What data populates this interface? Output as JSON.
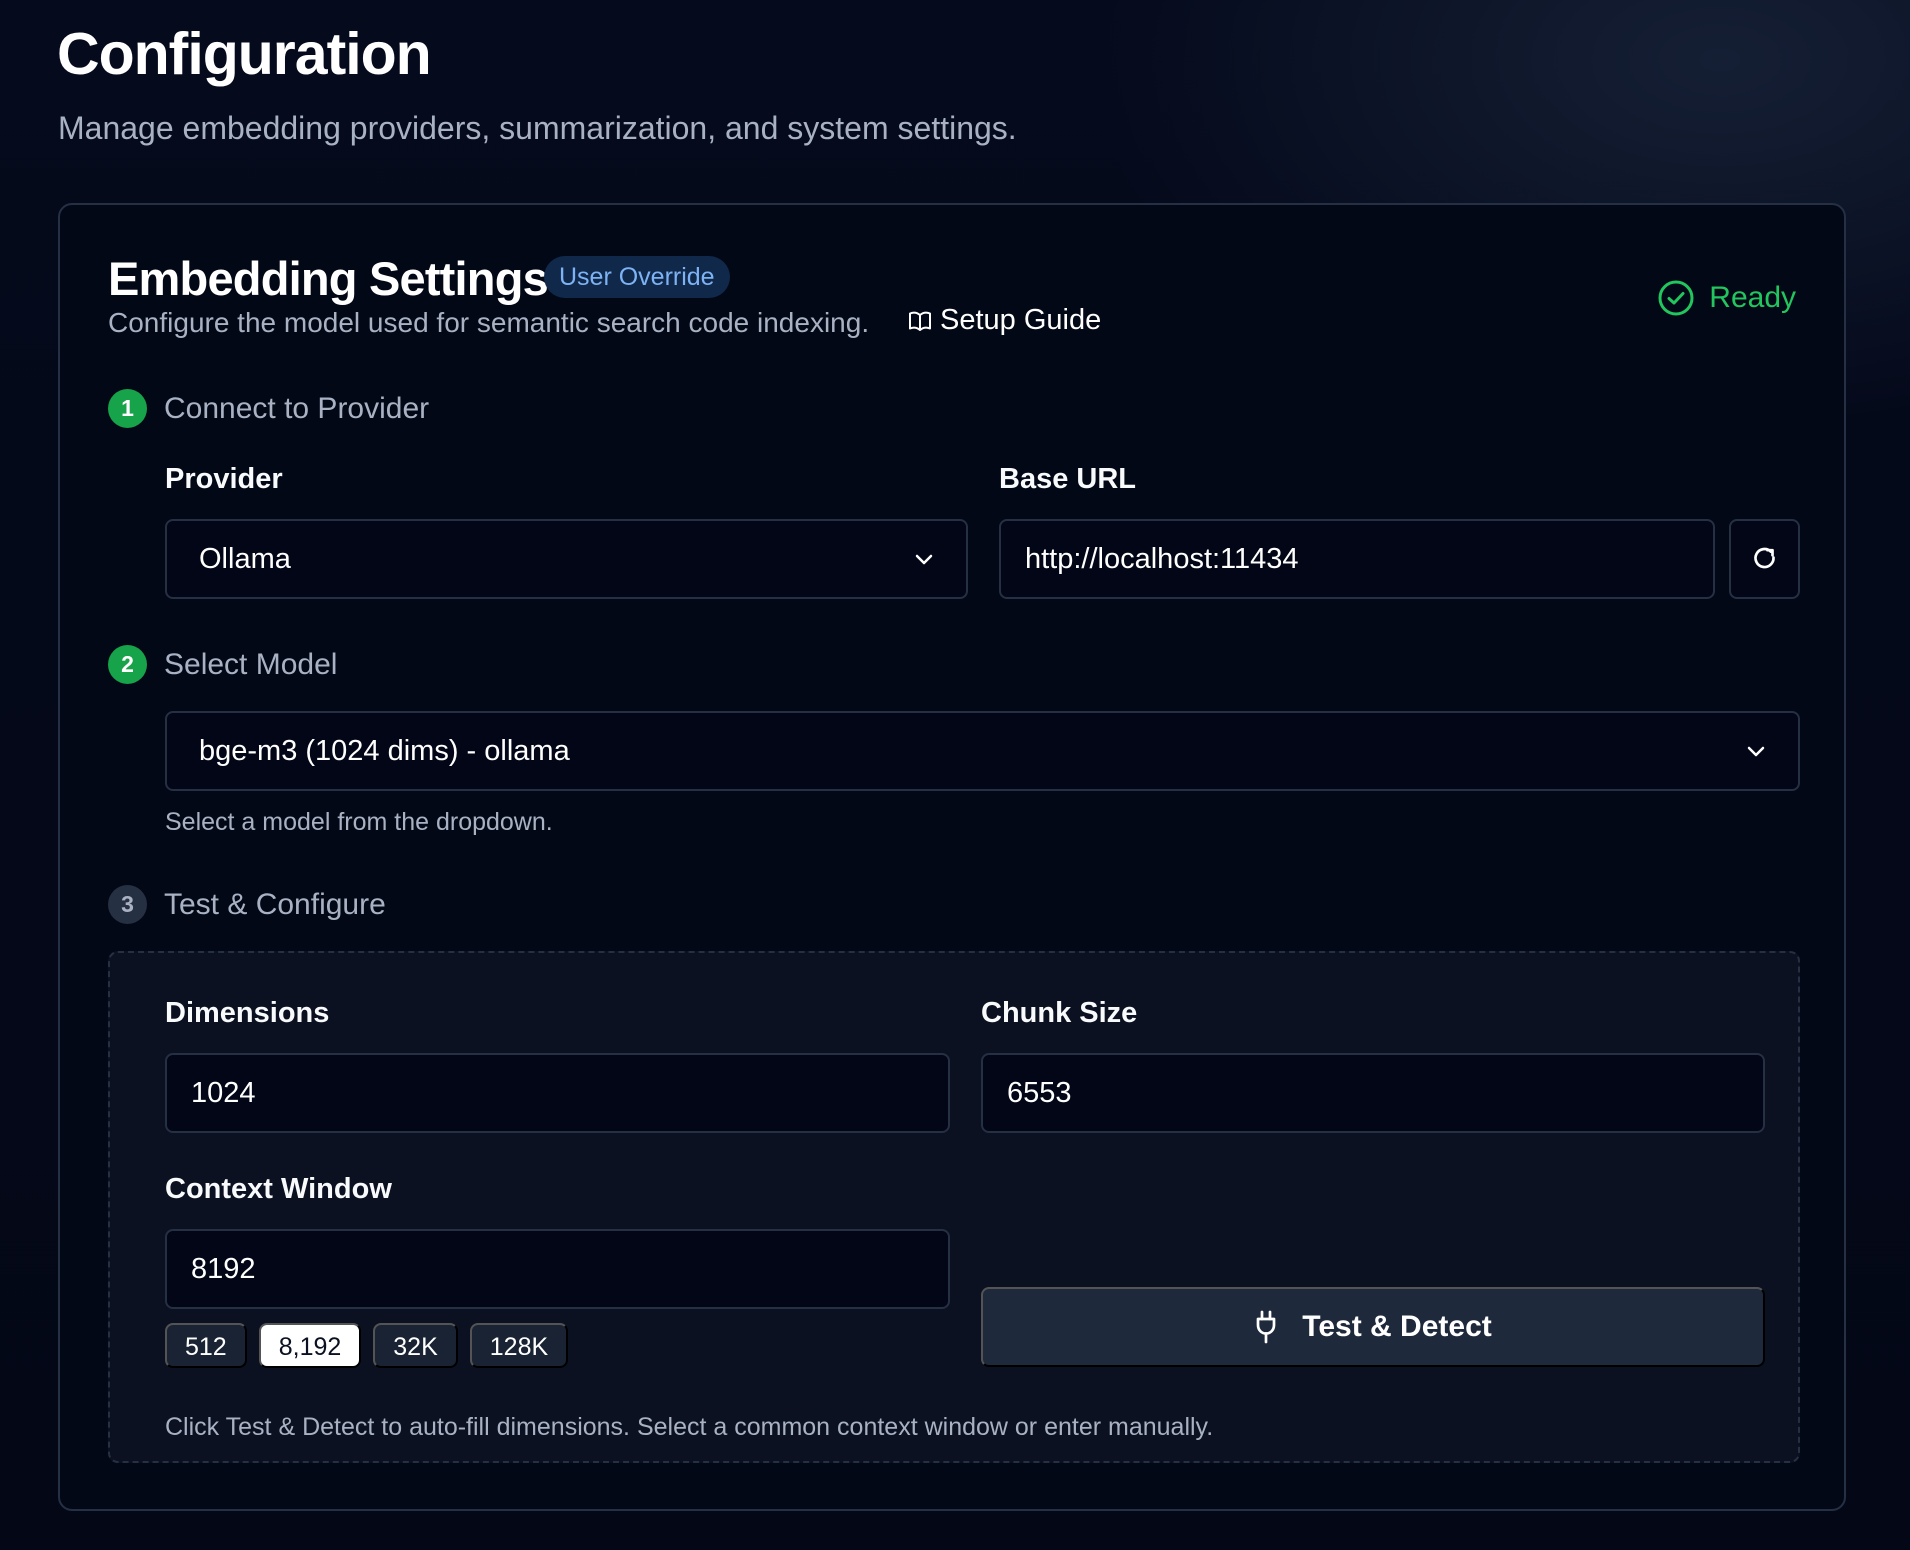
{
  "page": {
    "title": "Configuration",
    "subtitle": "Manage embedding providers, summarization, and system settings."
  },
  "card": {
    "title": "Embedding Settings",
    "badge": "User Override",
    "description": "Configure the model used for semantic search code indexing.",
    "setup_guide": "Setup Guide",
    "status": "Ready"
  },
  "steps": {
    "connect": {
      "number": "1",
      "label": "Connect to Provider"
    },
    "model": {
      "number": "2",
      "label": "Select Model"
    },
    "test": {
      "number": "3",
      "label": "Test & Configure"
    }
  },
  "provider": {
    "label": "Provider",
    "value": "Ollama"
  },
  "base_url": {
    "label": "Base URL",
    "value": "http://localhost:11434"
  },
  "model": {
    "value": "bge-m3 (1024 dims) - ollama",
    "helper": "Select a model from the dropdown."
  },
  "dimensions": {
    "label": "Dimensions",
    "value": "1024"
  },
  "chunk_size": {
    "label": "Chunk Size",
    "value": "6553"
  },
  "context_window": {
    "label": "Context Window",
    "value": "8192",
    "presets": [
      "512",
      "8,192",
      "32K",
      "128K"
    ],
    "selected_preset": "8,192"
  },
  "test_button": {
    "label": "Test & Detect"
  },
  "test_helper": "Click Test & Detect to auto-fill dimensions. Select a common context window or enter manually.",
  "icons": {
    "book": "book-icon",
    "status": "check-circle-icon",
    "select": "chevron-down-icon",
    "refresh": "refresh-icon",
    "test": "plug-icon"
  },
  "colors": {
    "accent_green": "#22c55e",
    "badge_blue": "#7db2f4",
    "panel_border": "#263043"
  }
}
